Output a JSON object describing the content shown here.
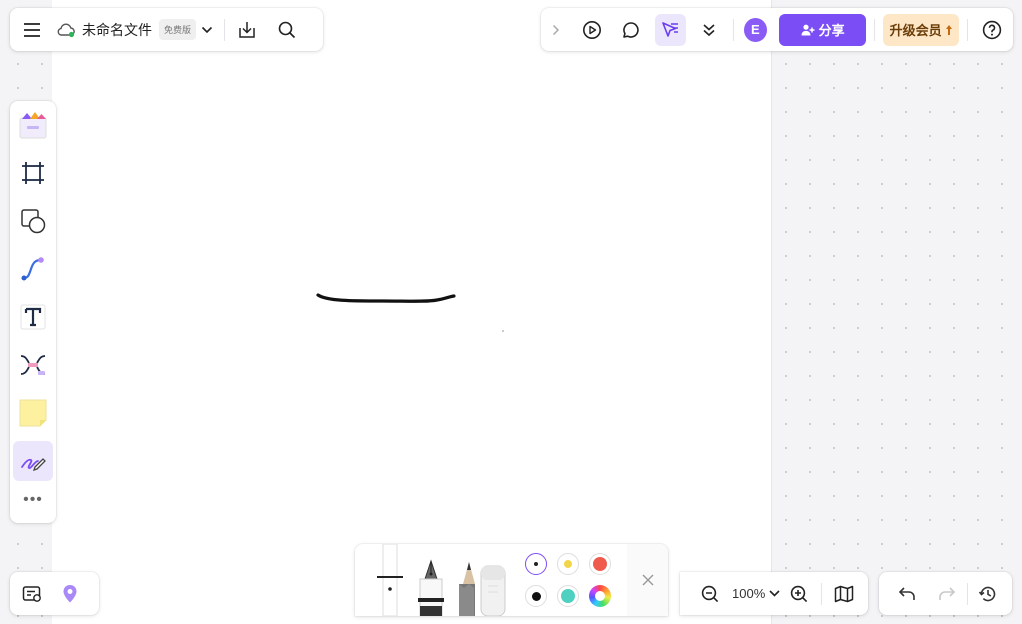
{
  "header": {
    "menu_icon": "hamburger-icon",
    "cloud_icon": "cloud-synced-icon",
    "file_name": "未命名文件",
    "plan_badge": "免费版"
  },
  "topbar_right": {
    "avatar_initial": "E",
    "share_label": "分享",
    "upgrade_label": "升级会员"
  },
  "toolbar": {
    "tools": [
      "templates",
      "frame",
      "shape",
      "connector",
      "text",
      "mindmap",
      "sticky-note",
      "pen"
    ],
    "selected_tool": "pen",
    "more_label": "•••"
  },
  "zoom": {
    "level": "100%"
  },
  "pen_toolbar": {
    "pens": [
      "marker",
      "fountain-pen",
      "pencil",
      "eraser"
    ],
    "colors": [
      "#ffffff",
      "#f2d64a",
      "#ef5a4c",
      "#111111",
      "#4fd1c1",
      "rainbow"
    ],
    "selected_color": "#ffffff"
  },
  "theme": {
    "accent": "#7b4df5",
    "upgrade_bg": "#fde7c7"
  }
}
